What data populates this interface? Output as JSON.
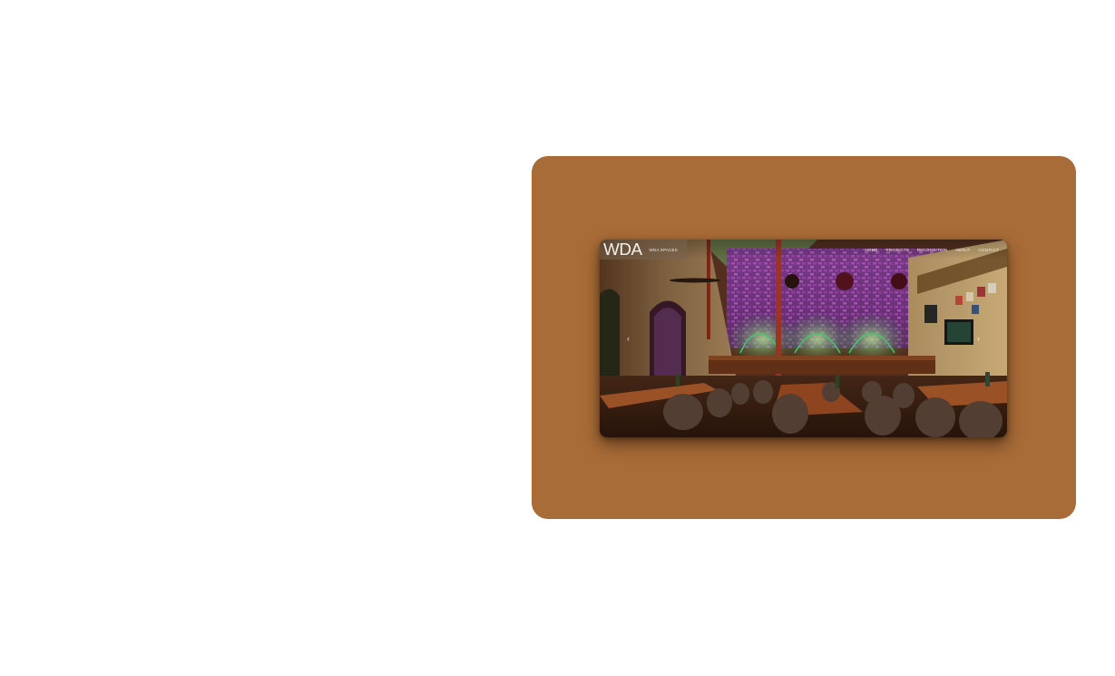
{
  "site": {
    "logo_text": "WDA",
    "brand_name": "WDA SPACES"
  },
  "nav": {
    "items": [
      {
        "label": "HOME",
        "active": true
      },
      {
        "label": "PROJECTS",
        "active": false
      },
      {
        "label": "RECOGNITION",
        "active": false
      },
      {
        "label": "ABOUT",
        "active": false
      },
      {
        "label": "CONTACT",
        "active": false
      }
    ]
  },
  "carousel": {
    "prev_icon": "‹",
    "next_icon": "›"
  },
  "colors": {
    "card_background": "#a86c38",
    "page_background": "#ffffff"
  }
}
